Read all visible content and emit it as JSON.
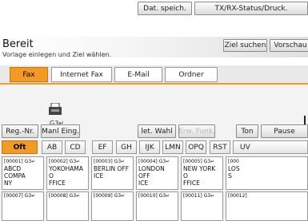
{
  "toolbar": {
    "store_label": "Dat. speich.",
    "status_label": "TX/RX-Status/Druck."
  },
  "header": {
    "title": "Bereit",
    "subtitle": "Vorlage einlegen und Ziel wählen.",
    "search_label": "Ziel suchen",
    "preview_label": "Vorschau"
  },
  "tabs": [
    {
      "label": "Fax",
      "active": true
    },
    {
      "label": "Internet Fax",
      "active": false
    },
    {
      "label": "E-Mail",
      "active": false
    },
    {
      "label": "Ordner",
      "active": false
    }
  ],
  "dest": {
    "line_text": "G3↵ _"
  },
  "actions": {
    "reg_label": "Reg.-Nr.",
    "manual_label": "Manl Eing.",
    "redial_label": "let. Wahl",
    "pause_disabled_label": "Erw. Funk.",
    "tone_label": "Ton",
    "pause_label": "Pause"
  },
  "filters": [
    "Oft",
    "AB",
    "CD",
    "EF",
    "GH",
    "IJK",
    "LMN",
    "OPQ",
    "RST",
    "UV"
  ],
  "destinations": [
    {
      "num": "[00001] G3↵",
      "line1": "ABCD COMPA",
      "line2": "NY"
    },
    {
      "num": "[00002] G3↵",
      "line1": "YOKOHAMA O",
      "line2": "FFICE"
    },
    {
      "num": "[00003] G3↵",
      "line1": "BERLIN OFF",
      "line2": "ICE"
    },
    {
      "num": "[00004] G3↵",
      "line1": "LONDON OFF",
      "line2": "ICE"
    },
    {
      "num": "[00005] G3↵",
      "line1": "NEW YORK O",
      "line2": "FFICE"
    },
    {
      "num": "[000",
      "line1": "LOS",
      "line2": "S"
    }
  ],
  "row2": [
    "[00007] G3↵",
    "[00008] G3↵",
    "[00009] G3↵",
    "[00010] G3↵",
    "[00011] G3↵",
    "[00012]"
  ],
  "colors": {
    "accent": "#f29a24"
  }
}
